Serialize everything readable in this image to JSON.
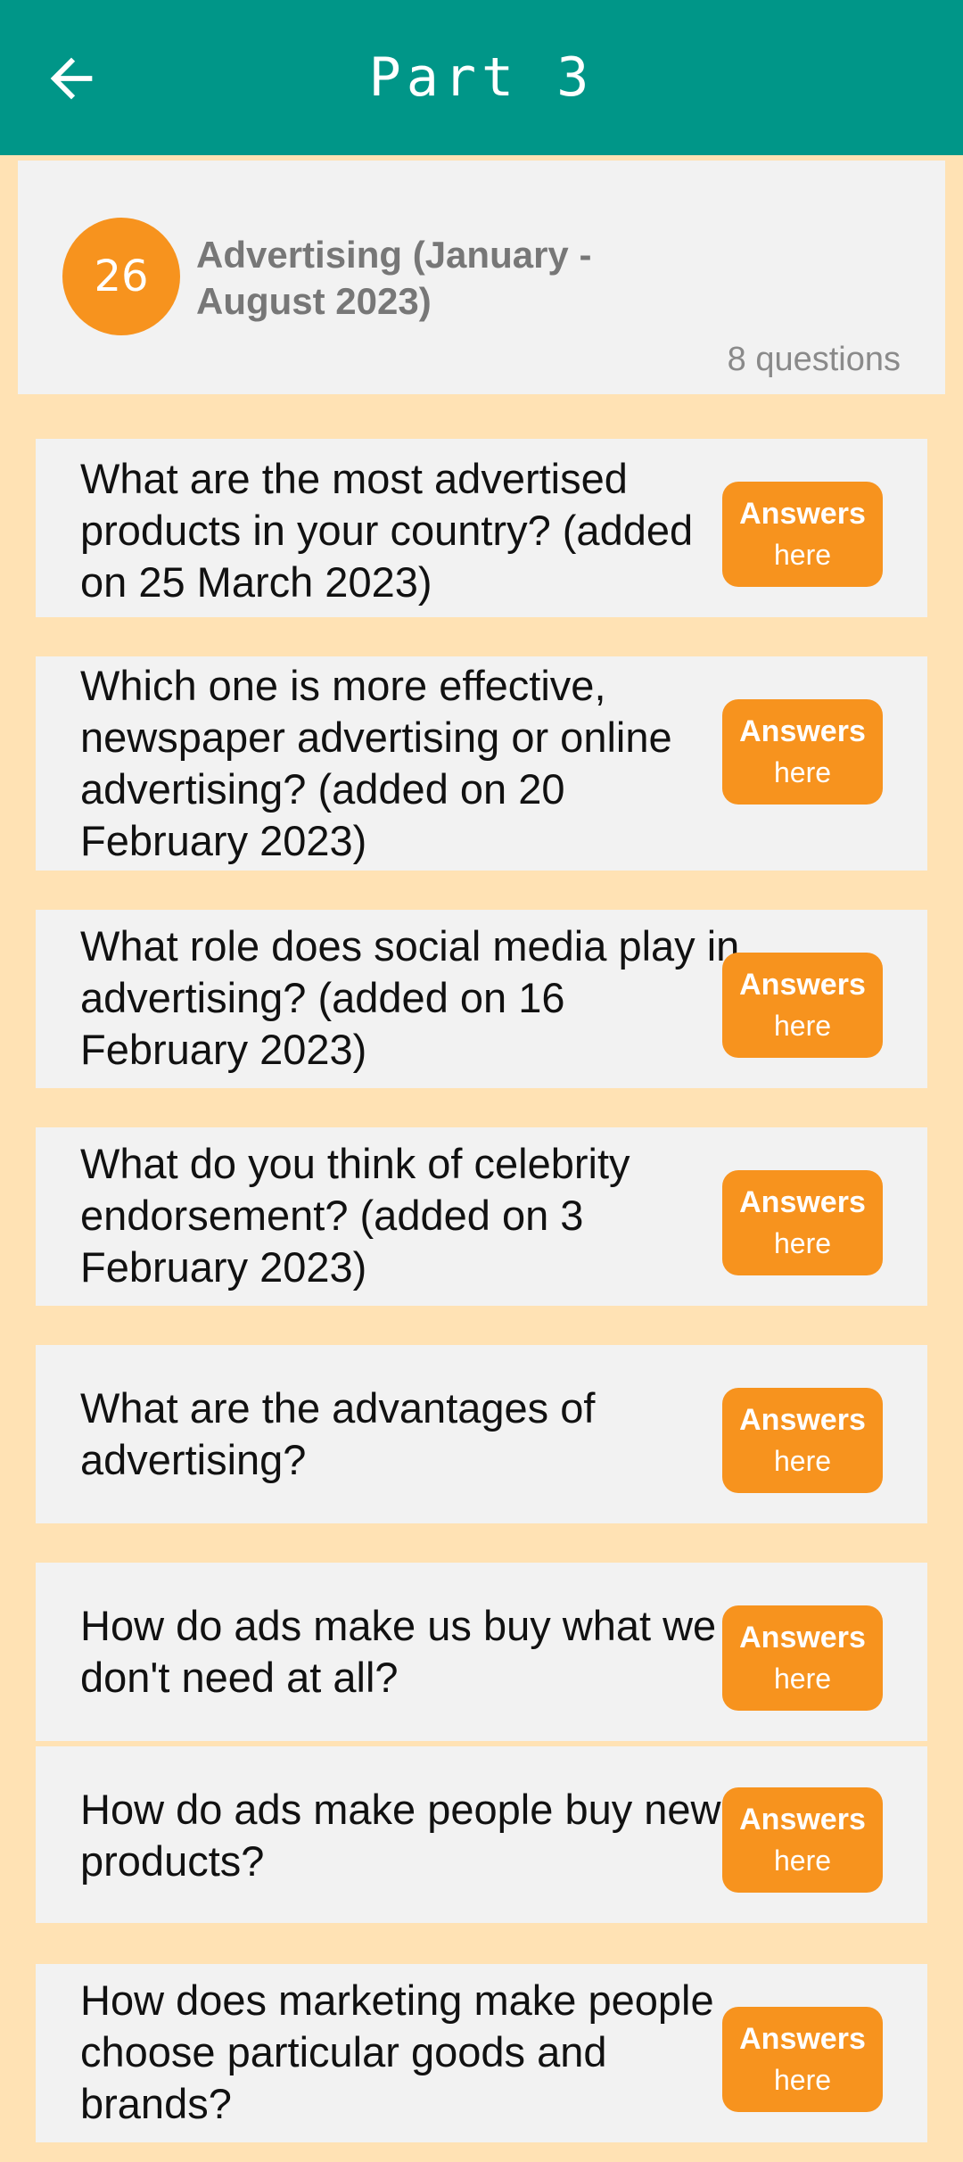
{
  "app_bar": {
    "title": "Part 3",
    "back_icon": "arrow-left-icon"
  },
  "topic": {
    "number": "26",
    "title": "Advertising (January - August 2023)",
    "count_label": "8 questions"
  },
  "answer_button": {
    "label_top": "Answers",
    "label_bottom": "here"
  },
  "questions": [
    "What are the most advertised products in your country? (added on 25 March 2023)",
    "Which one is more effective, newspaper advertising or online advertising? (added on 20 February 2023)",
    "What role does social media play in advertising? (added on 16 February 2023)",
    "What do you think of celebrity endorsement? (added on 3 February 2023)",
    "What are the advantages of advertising?",
    "How do ads make us buy what we don't need at all?",
    "How do ads make people buy new products?",
    "How does marketing make people choose particular goods and brands?"
  ],
  "colors": {
    "app_bar": "#009688",
    "background": "#FFE2B4",
    "accent": "#F7931E",
    "card": "#F2F2F2"
  }
}
